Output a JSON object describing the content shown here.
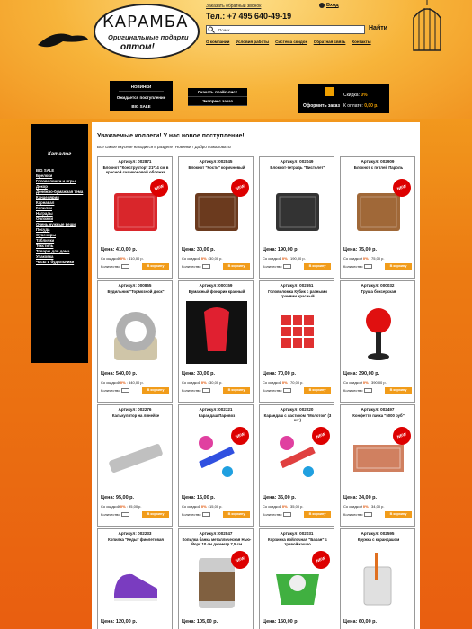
{
  "header": {
    "logo_title": "КАРАМБА",
    "logo_tagline_1": "Оригинальные подарки",
    "logo_tagline_2": "оптом!",
    "callback_link": "Заказать обратный звонок",
    "phone": "Тел.: +7 495 640-49-19",
    "login_label": "Вход",
    "search_placeholder": "Поиск",
    "search_button": "Найти",
    "nav": [
      "О компании",
      "Условия работы",
      "Система скидок",
      "Обратная связь",
      "Контакты"
    ]
  },
  "promo_boxes": {
    "left": [
      "НОВИНКИ",
      "Ожидается поступление",
      "BIG SALE"
    ],
    "right": [
      "Скачать прайс-лист",
      "Экспресс заказ"
    ]
  },
  "cart": {
    "checkout_label": "Оформить заказ",
    "discount_label": "Скидка:",
    "discount_value": "0%",
    "total_label": "К оплате:",
    "total_value": "0,00 р."
  },
  "sidebar": {
    "title": "Каталог",
    "items": [
      "BIG SALE",
      "Брелоки",
      "Головоломки и игры",
      "Декор",
      "Денежно-бумажная тема",
      "Канцелярия",
      "Карнавал",
      "Копилки",
      "Награды",
      "Обложки",
      "Очень нужные вещи",
      "Посуда",
      "Сувениры",
      "Таблички",
      "Текстиль",
      "Товары для дома",
      "Упаковка",
      "Часы и будильники"
    ]
  },
  "main": {
    "heading": "Уважаемые коллеги! У нас новое поступление!",
    "subtext": "Все самое вкусное находится в разделе \"Новинки\"! Добро пожаловать!"
  },
  "labels": {
    "discount_prefix": "Со скидкой",
    "quantity": "Количество",
    "buy": "В корзину",
    "new_badge": "NEW"
  },
  "products": [
    {
      "article": "Артикул: 002871",
      "name": "Блокнот \"Конструктор\" 21*14 см в красной силиконовой обложке",
      "price": "Цена: 410,00 р.",
      "discount_pct": "0%",
      "discount_price": "410,00 р.",
      "new": true,
      "color": "#d9262b",
      "icon": "notebook-icon"
    },
    {
      "article": "Артикул: 002845",
      "name": "Блокнот \"Кость\" коричневый",
      "price": "Цена: 30,00 р.",
      "discount_pct": "0%",
      "discount_price": "30,00 р.",
      "new": true,
      "color": "#6b3a1e",
      "icon": "notebook-icon"
    },
    {
      "article": "Артикул: 002049",
      "name": "Блокнот-тетрадь \"Пистолет\"",
      "price": "Цена: 190,00 р.",
      "discount_pct": "0%",
      "discount_price": "190,00 р.",
      "new": false,
      "color": "#333333",
      "icon": "notebook-icon"
    },
    {
      "article": "Артикул: 002909",
      "name": "Блокнот с петлей Пароль",
      "price": "Цена: 75,00 р.",
      "discount_pct": "0%",
      "discount_price": "75,00 р.",
      "new": true,
      "color": "#a06838",
      "icon": "notebook-icon"
    },
    {
      "article": "Артикул: 000855",
      "name": "Будильник \"Тормозной диск\"",
      "price": "Цена: 540,00 р.",
      "discount_pct": "0%",
      "discount_price": "540,00 р.",
      "new": false,
      "color": "#b0b0b0",
      "icon": "clock-icon"
    },
    {
      "article": "Артикул: 000159",
      "name": "Бумажный фонарик красный",
      "price": "Цена: 30,00 р.",
      "discount_pct": "0%",
      "discount_price": "30,00 р.",
      "new": false,
      "color": "#e02030",
      "icon": "lantern-icon"
    },
    {
      "article": "Артикул: 002651",
      "name": "Головоломка Кубик с разными гранями красный",
      "price": "Цена: 70,00 р.",
      "discount_pct": "0%",
      "discount_price": "70,00 р.",
      "new": false,
      "color": "#e03030",
      "icon": "cube-icon"
    },
    {
      "article": "Артикул: 000032",
      "name": "Груша боксерская",
      "price": "Цена: 390,00 р.",
      "discount_pct": "0%",
      "discount_price": "390,00 р.",
      "new": false,
      "color": "#e01010",
      "icon": "punching-bag-icon"
    },
    {
      "article": "Артикул: 002276",
      "name": "Калькулятор на линейке",
      "price": "Цена: 95,00 р.",
      "discount_pct": "0%",
      "discount_price": "95,00 р.",
      "new": false,
      "color": "#c0c0c0",
      "icon": "calculator-icon"
    },
    {
      "article": "Артикул: 002321",
      "name": "Карандаш Паровоз",
      "price": "Цена: 15,00 р.",
      "discount_pct": "0%",
      "discount_price": "15,00 р.",
      "new": true,
      "color": "#3050e0",
      "icon": "pencil-icon"
    },
    {
      "article": "Артикул: 002220",
      "name": "Карандаш с ластиком \"Молоток\" (3 шт.)",
      "price": "Цена: 35,00 р.",
      "discount_pct": "0%",
      "discount_price": "35,00 р.",
      "new": true,
      "color": "#e04040",
      "icon": "pencil-icon"
    },
    {
      "article": "Артикул: 002497",
      "name": "Конфетти пачка \"5000 руб\"",
      "price": "Цена: 34,00 р.",
      "discount_pct": "0%",
      "discount_price": "34,00 р.",
      "new": true,
      "color": "#d08060",
      "icon": "money-icon"
    },
    {
      "article": "Артикул: 002233",
      "name": "Копилка \"Кеды\" фиолетовая",
      "price": "Цена: 120,00 р.",
      "discount_pct": "0%",
      "discount_price": "120,00 р.",
      "new": false,
      "color": "#7a3cc0",
      "icon": "sneaker-icon"
    },
    {
      "article": "Артикул: 002847",
      "name": "Копилка банка металлическая Нью-Йорк 10 см диаметр 7,5 см",
      "price": "Цена: 105,00 р.",
      "discount_pct": "0%",
      "discount_price": "105,00 р.",
      "new": true,
      "color": "#806040",
      "icon": "jar-icon"
    },
    {
      "article": "Артикул: 002031",
      "name": "Корзинка войлочная \"Баран\" с травой кашпо",
      "price": "Цена: 150,00 р.",
      "discount_pct": "0%",
      "discount_price": "150,00 р.",
      "new": true,
      "color": "#40b040",
      "icon": "basket-icon"
    },
    {
      "article": "Артикул: 002595",
      "name": "Кружка с карандашом",
      "price": "Цена: 60,00 р.",
      "discount_pct": "0%",
      "discount_price": "60,00 р.",
      "new": false,
      "color": "#e0e0e0",
      "icon": "mug-icon"
    }
  ]
}
